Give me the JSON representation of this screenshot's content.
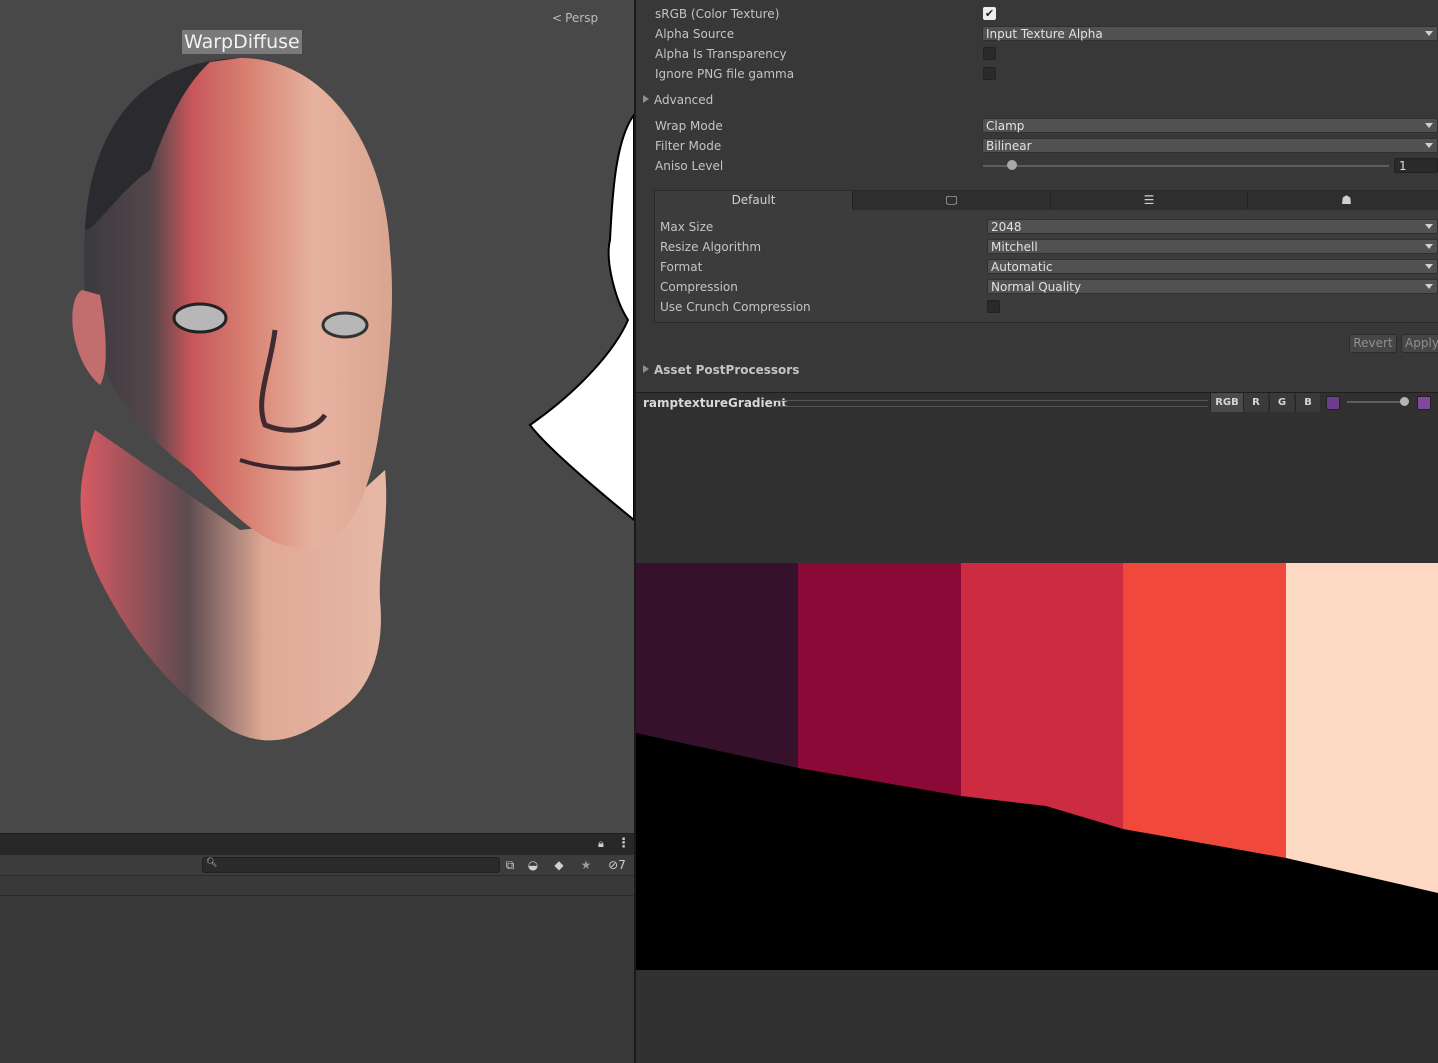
{
  "scene": {
    "projection_label": "Persp",
    "model_label": "WarpDiffuse"
  },
  "bottom_left": {
    "hidden_count": "7"
  },
  "inspector": {
    "srgb_label": "sRGB (Color Texture)",
    "srgb_checked": true,
    "alpha_source_label": "Alpha Source",
    "alpha_source_value": "Input Texture Alpha",
    "alpha_transparency_label": "Alpha Is Transparency",
    "ignore_png_gamma_label": "Ignore PNG file gamma",
    "advanced_label": "Advanced",
    "wrap_mode_label": "Wrap Mode",
    "wrap_mode_value": "Clamp",
    "filter_mode_label": "Filter Mode",
    "filter_mode_value": "Bilinear",
    "aniso_level_label": "Aniso Level",
    "aniso_level_value": "1",
    "platform_tabs": {
      "default_label": "Default",
      "icons": [
        "monitor-icon",
        "server-icon",
        "android-icon"
      ]
    },
    "max_size_label": "Max Size",
    "max_size_value": "2048",
    "resize_algorithm_label": "Resize Algorithm",
    "resize_algorithm_value": "Mitchell",
    "format_label": "Format",
    "format_value": "Automatic",
    "compression_label": "Compression",
    "compression_value": "Normal Quality",
    "crunch_label": "Use Crunch Compression",
    "revert_label": "Revert",
    "apply_label": "Apply",
    "postprocessors_label": "Asset PostProcessors"
  },
  "preview": {
    "name": "ramptextureGradient",
    "channels": [
      "RGB",
      "R",
      "G",
      "B"
    ],
    "ramp_colors": [
      "#35112c",
      "#8b0937",
      "#cd2b42",
      "#f1483c",
      "#fdd8c3"
    ]
  }
}
